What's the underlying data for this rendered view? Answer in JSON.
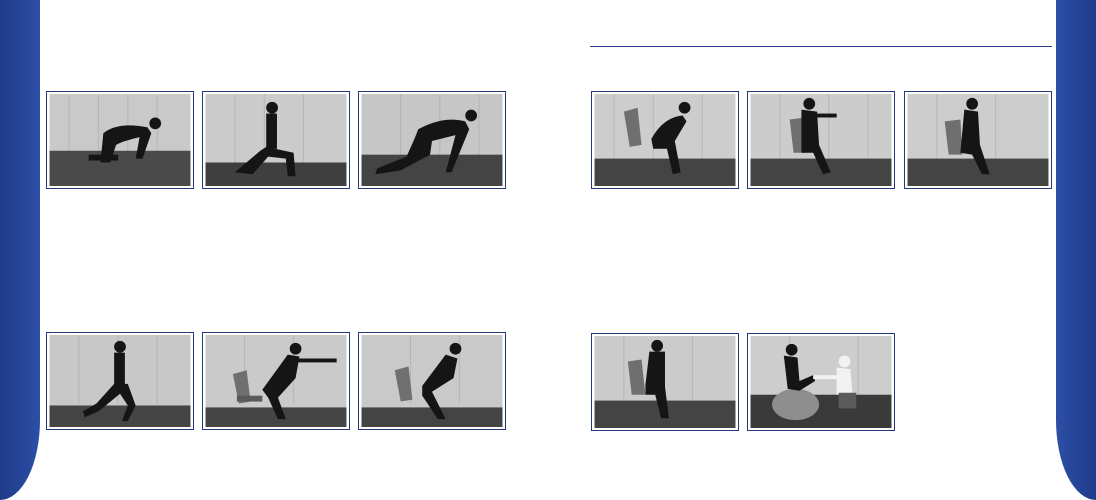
{
  "colors": {
    "accent": "#1f3a8a",
    "photo_border": "#233a7a"
  },
  "left_page": {
    "top_row": [
      {
        "icon": "kneeling-reach-photo"
      },
      {
        "icon": "half-kneel-photo"
      },
      {
        "icon": "lunge-reach-photo"
      }
    ],
    "bottom_row": [
      {
        "icon": "standing-lunge-photo"
      },
      {
        "icon": "chair-squat-arms-photo"
      },
      {
        "icon": "chair-squat-photo"
      }
    ]
  },
  "right_page": {
    "top_row": [
      {
        "icon": "seated-forward-bend-photo"
      },
      {
        "icon": "seated-twist-photo"
      },
      {
        "icon": "seated-side-twist-photo"
      }
    ],
    "bottom_row": [
      {
        "icon": "seated-upright-photo"
      },
      {
        "icon": "therapy-ball-assisted-photo"
      }
    ]
  }
}
